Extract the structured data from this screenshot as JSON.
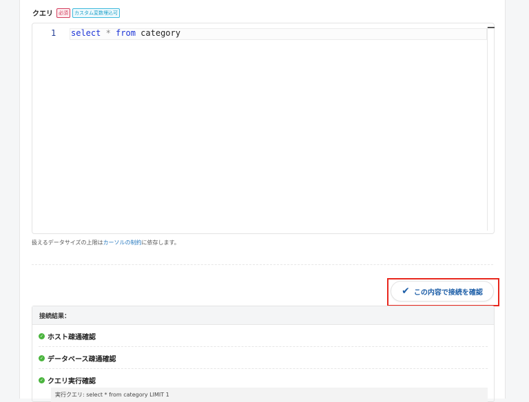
{
  "form": {
    "query_label": "クエリ",
    "required_badge": "必須",
    "custom_var_badge": "カスタム変数埋込可",
    "editor": {
      "line_number": "1",
      "code_keyword1": "select",
      "code_op": " * ",
      "code_keyword2": "from",
      "code_rest": " category"
    },
    "note_prefix": "扱えるデータサイズの上限は",
    "note_link": "カーソルの制約",
    "note_suffix": "に依存します。"
  },
  "actions": {
    "check_connection_label": "この内容で接続を確認"
  },
  "result": {
    "title": "接続結果：",
    "items": [
      {
        "label": "ホスト疎通確認"
      },
      {
        "label": "データベース疎通確認"
      },
      {
        "label": "クエリ実行確認"
      }
    ],
    "executed_query": "実行クエリ: select * from category LIMIT 1"
  }
}
